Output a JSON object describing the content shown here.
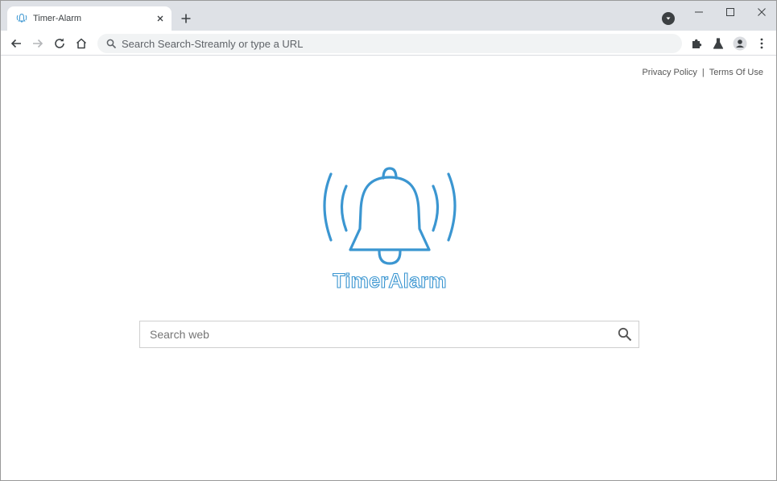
{
  "browser": {
    "tab": {
      "title": "Timer-Alarm"
    },
    "omnibox": {
      "placeholder": "Search Search-Streamly or type a URL"
    }
  },
  "page": {
    "links": {
      "privacy": "Privacy Policy",
      "separator": "|",
      "terms": "Terms Of Use"
    },
    "logo": {
      "text": "TimerAlarm",
      "color": "#3b96d1"
    },
    "search": {
      "placeholder": "Search web"
    }
  },
  "icons": {
    "tab_favicon": "bell-icon",
    "tab_close": "close-icon",
    "new_tab": "plus-icon",
    "back": "arrow-left-icon",
    "forward": "arrow-right-icon",
    "reload": "reload-icon",
    "home": "home-icon",
    "omnibox": "search-icon",
    "extensions": "puzzle-icon",
    "labs": "flask-icon",
    "profile": "avatar-icon",
    "menu": "kebab-menu-icon",
    "search": "search-icon"
  }
}
